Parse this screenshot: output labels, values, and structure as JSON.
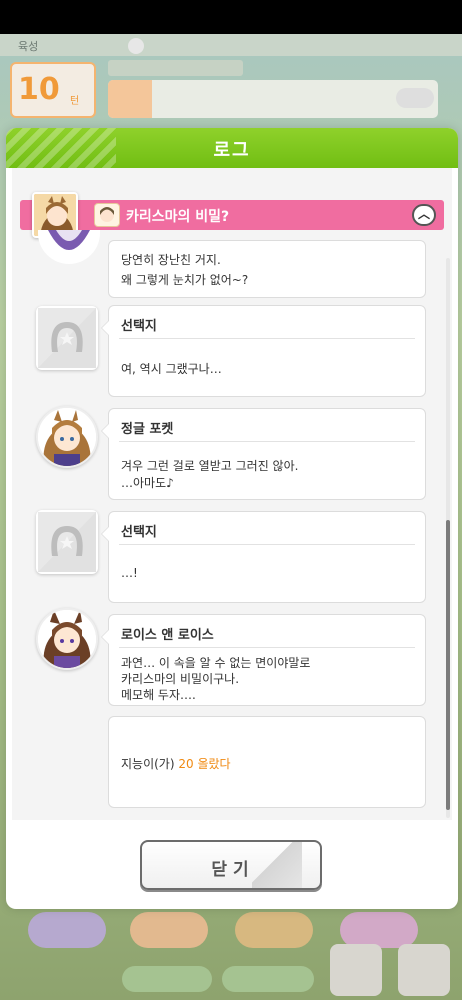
{
  "background": {
    "turn_label": "육성",
    "date_number": "10",
    "date_unit": "턴"
  },
  "modal": {
    "title": "로그",
    "close_label": "닫기"
  },
  "event": {
    "title": "카리스마의 비밀?"
  },
  "entries": [
    {
      "type": "dialogue",
      "speaker": "",
      "lines": [
        "당연히 장난친 거지.",
        "왜 그렇게 눈치가 없어~?"
      ]
    },
    {
      "type": "choice",
      "speaker": "선택지",
      "lines": [
        "여, 역시 그랬구나…"
      ]
    },
    {
      "type": "dialogue",
      "speaker": "정글 포켓",
      "lines": [
        "겨우 그런 걸로 열받고 그러진 않아.",
        "…아마도♪"
      ]
    },
    {
      "type": "choice",
      "speaker": "선택지",
      "lines": [
        "…!"
      ]
    },
    {
      "type": "dialogue",
      "speaker": "로이스 앤 로이스",
      "lines": [
        "과연… 이 속을 알 수 없는 면이야말로",
        "카리스마의 비밀이구나.",
        "메모해 두자…."
      ]
    },
    {
      "type": "result",
      "prefix": "지능이(가) ",
      "value": "20",
      "suffix": " 올랐다"
    }
  ],
  "colors": {
    "header_green": "#7dc51c",
    "event_pink": "#f06da0",
    "result_orange": "#f08a12"
  }
}
